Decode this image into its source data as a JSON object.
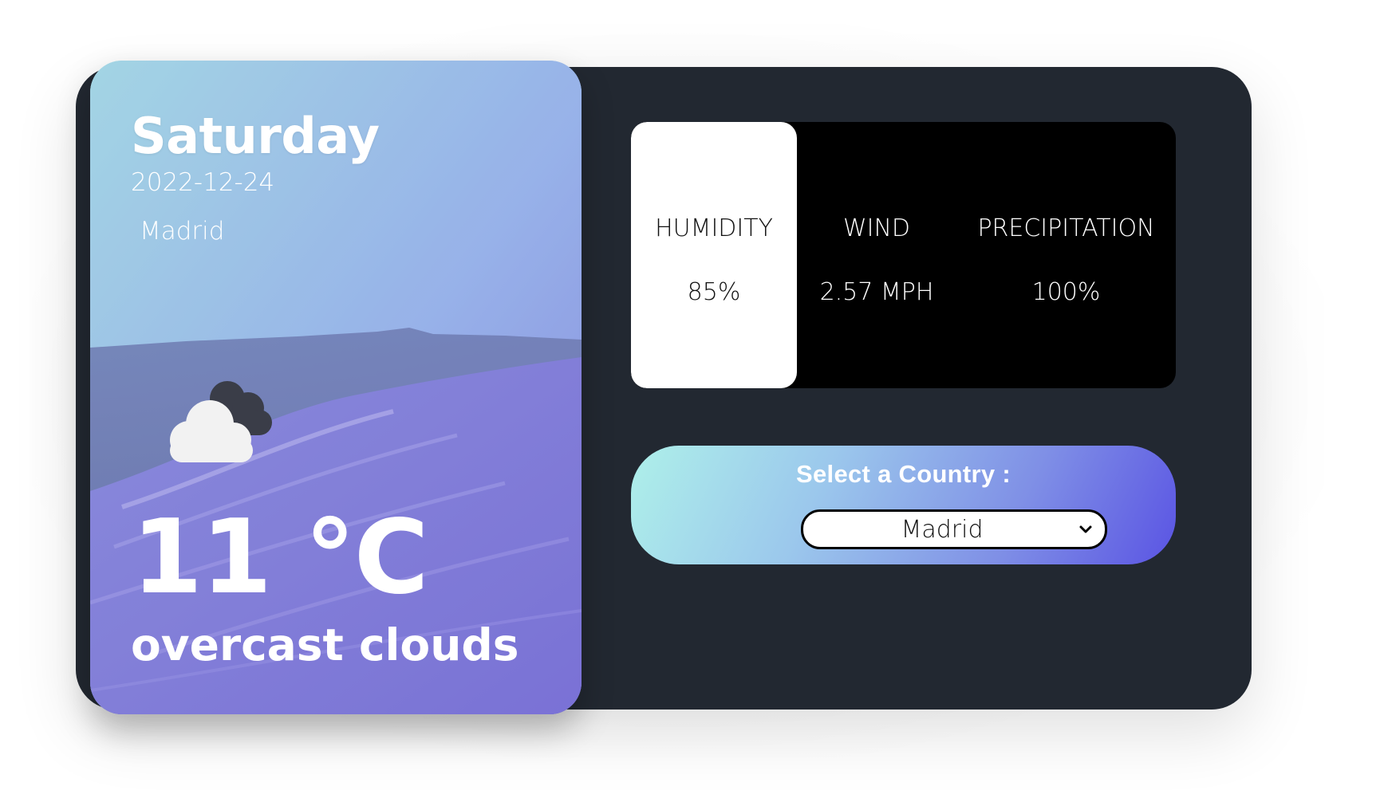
{
  "weather_card": {
    "day": "Saturday",
    "date": "2022-12-24",
    "city": "Madrid",
    "temperature": "11 °C",
    "description": "overcast clouds",
    "icon": "overcast-clouds-icon"
  },
  "stats": {
    "humidity": {
      "label": "HUMIDITY",
      "value": "85%"
    },
    "wind": {
      "label": "WIND",
      "value": "2.57 MPH"
    },
    "precipitation": {
      "label": "PRECIPITATION",
      "value": "100%"
    }
  },
  "country_selector": {
    "label": "Select a Country :",
    "selected": "Madrid",
    "icon": "chevron-down-icon"
  },
  "colors": {
    "app_background": "#222831",
    "stats_background": "#000000",
    "active_stat_background": "#ffffff",
    "gradient_start": "#aef0ea",
    "gradient_end": "#5a54e3"
  }
}
